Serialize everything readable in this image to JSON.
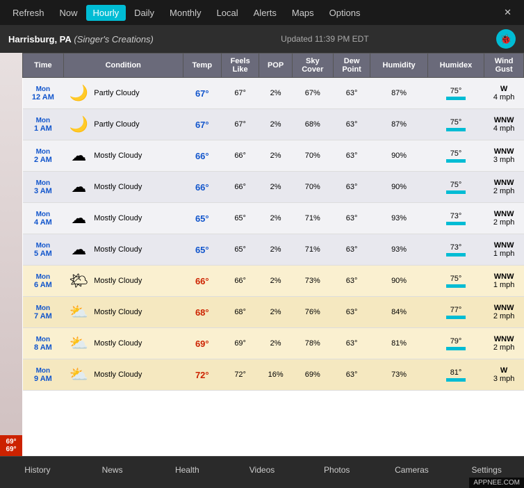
{
  "nav": {
    "items": [
      "Refresh",
      "Now",
      "Hourly",
      "Daily",
      "Monthly",
      "Local",
      "Alerts",
      "Maps",
      "Options"
    ],
    "active": "Hourly"
  },
  "location": {
    "city": "Harrisburg, PA",
    "subtitle": "(Singer's Creations)",
    "updated": "Updated 11:39 PM EDT"
  },
  "table": {
    "headers": [
      "Time",
      "Condition",
      "Temp",
      "Feels Like",
      "POP",
      "Sky Cover",
      "Dew Point",
      "Humidity",
      "Humidex",
      "Wind Gust"
    ],
    "rows": [
      {
        "day": "Mon",
        "hour": "12 AM",
        "condition": "Partly Cloudy",
        "icon": "🌙",
        "temp": "67°",
        "feels": "67°",
        "pop": "2%",
        "sky": "67%",
        "dew": "63°",
        "hum": "87%",
        "humidex": "75°",
        "wind": "W",
        "gust": "4 mph",
        "warm": false,
        "morning": false
      },
      {
        "day": "Mon",
        "hour": "1 AM",
        "condition": "Partly Cloudy",
        "icon": "🌙",
        "temp": "67°",
        "feels": "67°",
        "pop": "2%",
        "sky": "68%",
        "dew": "63°",
        "hum": "87%",
        "humidex": "75°",
        "wind": "WNW",
        "gust": "4 mph",
        "warm": false,
        "morning": false
      },
      {
        "day": "Mon",
        "hour": "2 AM",
        "condition": "Mostly Cloudy",
        "icon": "☁",
        "temp": "66°",
        "feels": "66°",
        "pop": "2%",
        "sky": "70%",
        "dew": "63°",
        "hum": "90%",
        "humidex": "75°",
        "wind": "WNW",
        "gust": "3 mph",
        "warm": false,
        "morning": false
      },
      {
        "day": "Mon",
        "hour": "3 AM",
        "condition": "Mostly Cloudy",
        "icon": "☁",
        "temp": "66°",
        "feels": "66°",
        "pop": "2%",
        "sky": "70%",
        "dew": "63°",
        "hum": "90%",
        "humidex": "75°",
        "wind": "WNW",
        "gust": "2 mph",
        "warm": false,
        "morning": false
      },
      {
        "day": "Mon",
        "hour": "4 AM",
        "condition": "Mostly Cloudy",
        "icon": "☁",
        "temp": "65°",
        "feels": "65°",
        "pop": "2%",
        "sky": "71%",
        "dew": "63°",
        "hum": "93%",
        "humidex": "73°",
        "wind": "WNW",
        "gust": "2 mph",
        "warm": false,
        "morning": false
      },
      {
        "day": "Mon",
        "hour": "5 AM",
        "condition": "Mostly Cloudy",
        "icon": "☁",
        "temp": "65°",
        "feels": "65°",
        "pop": "2%",
        "sky": "71%",
        "dew": "63°",
        "hum": "93%",
        "humidex": "73°",
        "wind": "WNW",
        "gust": "1 mph",
        "warm": false,
        "morning": false
      },
      {
        "day": "Mon",
        "hour": "6 AM",
        "condition": "Mostly Cloudy",
        "icon": "🌤",
        "temp": "66°",
        "feels": "66°",
        "pop": "2%",
        "sky": "73%",
        "dew": "63°",
        "hum": "90%",
        "humidex": "75°",
        "wind": "WNW",
        "gust": "1 mph",
        "warm": true,
        "morning": true
      },
      {
        "day": "Mon",
        "hour": "7 AM",
        "condition": "Mostly Cloudy",
        "icon": "⛅",
        "temp": "68°",
        "feels": "68°",
        "pop": "2%",
        "sky": "76%",
        "dew": "63°",
        "hum": "84%",
        "humidex": "77°",
        "wind": "WNW",
        "gust": "2 mph",
        "warm": true,
        "morning": true
      },
      {
        "day": "Mon",
        "hour": "8 AM",
        "condition": "Mostly Cloudy",
        "icon": "⛅",
        "temp": "69°",
        "feels": "69°",
        "pop": "2%",
        "sky": "78%",
        "dew": "63°",
        "hum": "81%",
        "humidex": "79°",
        "wind": "WNW",
        "gust": "2 mph",
        "warm": true,
        "morning": true
      },
      {
        "day": "Mon",
        "hour": "9 AM",
        "condition": "Mostly Cloudy",
        "icon": "⛅",
        "temp": "72°",
        "feels": "72°",
        "pop": "16%",
        "sky": "69%",
        "dew": "63°",
        "hum": "73%",
        "humidex": "81°",
        "wind": "W",
        "gust": "3 mph",
        "warm": true,
        "morning": true
      }
    ]
  },
  "footer": {
    "items": [
      "History",
      "News",
      "Health",
      "Videos",
      "Photos",
      "Cameras",
      "Settings"
    ]
  },
  "current_temp": "69°",
  "current_low": "69°"
}
